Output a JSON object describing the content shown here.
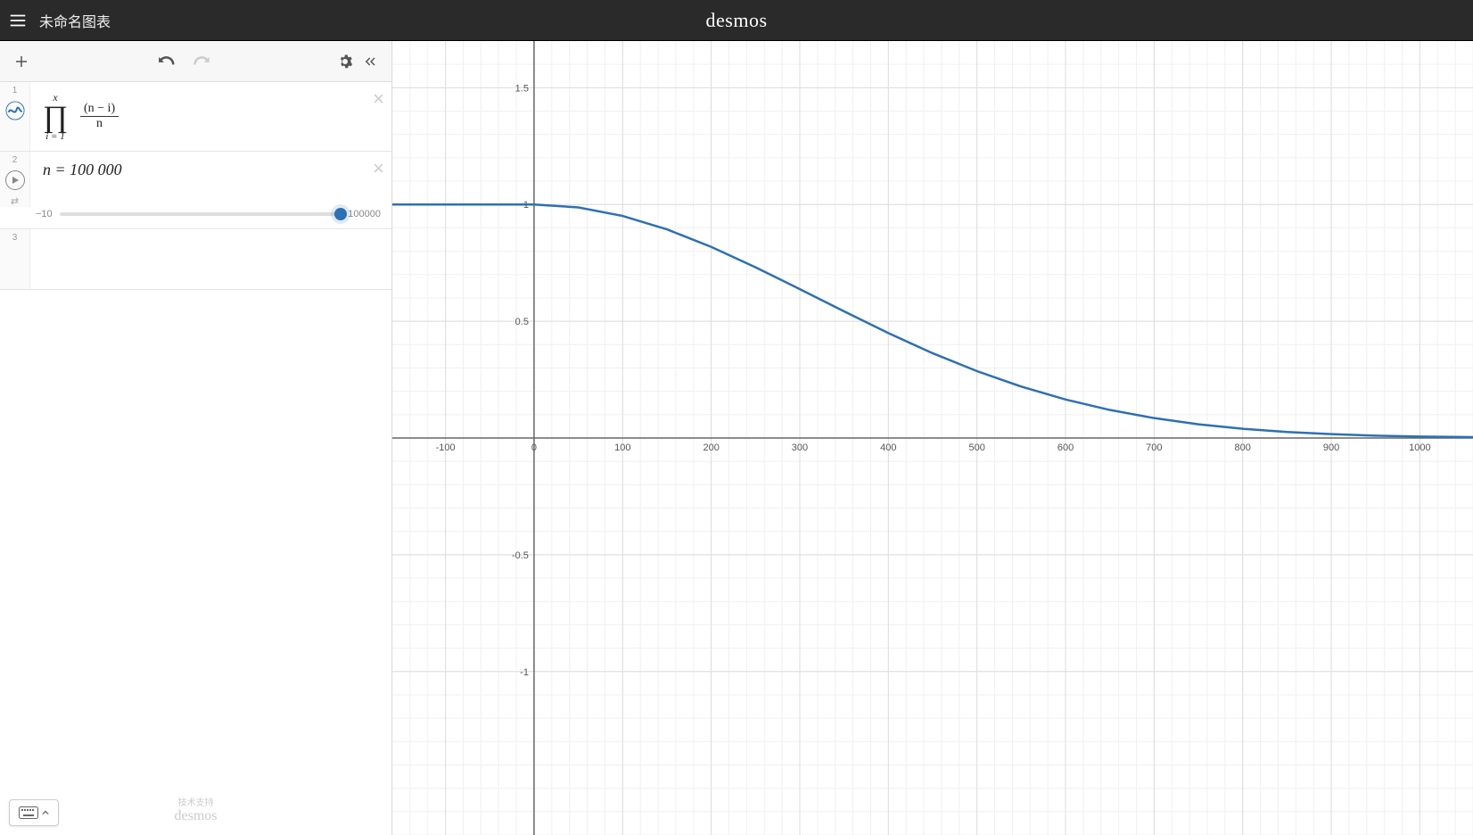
{
  "header": {
    "title": "未命名图表",
    "brand": "desmos"
  },
  "expressions": [
    {
      "num": "1",
      "type": "formula",
      "upper": "x",
      "lower": "i = 1",
      "frac_top": "(n − i)",
      "frac_bot": "n"
    },
    {
      "num": "2",
      "type": "slider",
      "label": "n = 100 000",
      "min": "−10",
      "max": "100000"
    },
    {
      "num": "3",
      "type": "empty"
    }
  ],
  "footer": {
    "powered": "技术支持",
    "brand": "desmos"
  },
  "chart_data": {
    "type": "line",
    "title": "",
    "xlabel": "",
    "ylabel": "",
    "xlim": [
      -160,
      1060
    ],
    "ylim": [
      -1.7,
      1.7
    ],
    "x_ticks": [
      -100,
      0,
      100,
      200,
      300,
      400,
      500,
      600,
      700,
      800,
      900,
      1000
    ],
    "y_ticks": [
      -1,
      -0.5,
      0.5,
      1,
      1.5
    ],
    "series": [
      {
        "name": "prod((n-i)/n, i=1..x), n=100000",
        "color": "#2d70b3",
        "x": [
          -160,
          -100,
          -50,
          0,
          50,
          100,
          150,
          200,
          250,
          300,
          350,
          400,
          450,
          500,
          550,
          600,
          650,
          700,
          750,
          800,
          850,
          900,
          950,
          1000,
          1060
        ],
        "y": [
          1.0,
          1.0,
          1.0,
          1.0,
          0.9876,
          0.951,
          0.8936,
          0.8185,
          0.7312,
          0.6376,
          0.5424,
          0.4492,
          0.3631,
          0.2865,
          0.2203,
          0.1649,
          0.1202,
          0.0853,
          0.0589,
          0.0396,
          0.0259,
          0.0165,
          0.0102,
          0.0062,
          0.0037
        ]
      }
    ]
  }
}
